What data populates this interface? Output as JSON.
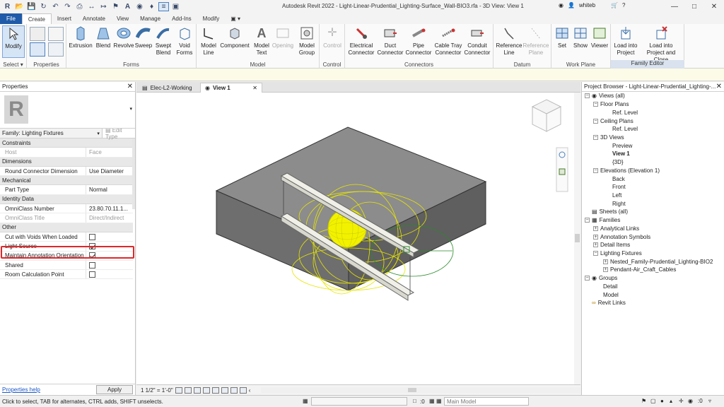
{
  "app": {
    "title": "Autodesk Revit 2022 - Light-Linear-Prudential_Lighting-Surface_Wall-BIO3.rfa - 3D View: View 1",
    "user": "whiteb",
    "logo_letter": "R"
  },
  "menu": {
    "tabs": [
      "File",
      "Create",
      "Insert",
      "Annotate",
      "View",
      "Manage",
      "Add-Ins",
      "Modify"
    ],
    "active": "Create"
  },
  "ribbon": {
    "groups": {
      "select": "Select",
      "properties": "Properties",
      "forms": "Forms",
      "model": "Model",
      "control": "Control",
      "connectors": "Connectors",
      "datum": "Datum",
      "work_plane": "Work Plane",
      "family_editor": "Family Editor"
    },
    "buttons": {
      "modify": "Modify",
      "extrusion": "Extrusion",
      "blend": "Blend",
      "revolve": "Revolve",
      "sweep": "Sweep",
      "swept_blend_1": "Swept",
      "swept_blend_2": "Blend",
      "void_forms_1": "Void",
      "void_forms_2": "Forms",
      "model_line_1": "Model",
      "model_line_2": "Line",
      "component": "Component",
      "model_text_1": "Model",
      "model_text_2": "Text",
      "opening": "Opening",
      "model_group_1": "Model",
      "model_group_2": "Group",
      "control": "Control",
      "electrical_1": "Electrical",
      "electrical_2": "Connector",
      "duct_1": "Duct",
      "duct_2": "Connector",
      "pipe_1": "Pipe",
      "pipe_2": "Connector",
      "cable_tray_1": "Cable Tray",
      "cable_tray_2": "Connector",
      "conduit_1": "Conduit",
      "conduit_2": "Connector",
      "ref_line_1": "Reference",
      "ref_line_2": "Line",
      "ref_plane_1": "Reference",
      "ref_plane_2": "Plane",
      "set": "Set",
      "show": "Show",
      "viewer": "Viewer",
      "load_project_1": "Load into",
      "load_project_2": "Project",
      "load_close_1": "Load into",
      "load_close_2": "Project and Close"
    }
  },
  "properties": {
    "panel_title": "Properties",
    "family": "Family: Lighting Fixtures",
    "edit_type": "Edit Type",
    "categories": {
      "constraints": "Constraints",
      "dimensions": "Dimensions",
      "mechanical": "Mechanical",
      "identity": "Identity Data",
      "other": "Other"
    },
    "rows": {
      "host_name": "Host",
      "host_value": "Face",
      "rcd_name": "Round Connector Dimension",
      "rcd_value": "Use Diameter",
      "part_name": "Part Type",
      "part_value": "Normal",
      "omni_num_name": "OmniClass Number",
      "omni_num_value": "23.80.70.11.1...",
      "omni_title_name": "OmniClass Title",
      "omni_title_value": "Direct/Indirect",
      "cut_voids": "Cut with Voids When Loaded",
      "light_source": "Light Source",
      "maintain_annot": "Maintain Annotation Orientation",
      "shared": "Shared",
      "room_calc": "Room Calculation Point"
    },
    "checkboxes": {
      "cut_voids": false,
      "light_source": true,
      "maintain_annot": true,
      "shared": false,
      "room_calc": false
    },
    "help_link": "Properties help",
    "apply": "Apply"
  },
  "view_tabs": {
    "tab1": "Elec-L2-Working",
    "tab2": "View 1"
  },
  "view_control": {
    "scale": "1 1/2\" = 1'-0\""
  },
  "browser": {
    "title": "Project Browser - Light-Linear-Prudential_Lighting-...",
    "views": "Views (all)",
    "floor_plans": "Floor Plans",
    "ref_level_1": "Ref. Level",
    "ceiling_plans": "Ceiling Plans",
    "ref_level_2": "Ref. Level",
    "views_3d": "3D Views",
    "preview": "Preview",
    "view1": "View 1",
    "view3d": "{3D}",
    "elevations": "Elevations (Elevation 1)",
    "back": "Back",
    "front": "Front",
    "left": "Left",
    "right": "Right",
    "sheets": "Sheets (all)",
    "families": "Families",
    "analytical_links": "Analytical Links",
    "annotation_symbols": "Annotation Symbols",
    "detail_items": "Detail Items",
    "lighting_fixtures": "Lighting Fixtures",
    "nested_family": "Nested_Family-Prudential_Lighting-BIO2",
    "pendant_cables": "Pendant-Air_Craft_Cables",
    "groups": "Groups",
    "detail": "Detail",
    "model": "Model",
    "revit_links": "Revit Links"
  },
  "status": {
    "message": "Click to select, TAB for alternates, CTRL adds, SHIFT unselects.",
    "zero": ":0",
    "main_model": "Main Model"
  },
  "colors": {
    "accent": "#1f5ba8",
    "highlight": "#e0262a",
    "light_yellow": "#f2f200",
    "slab": "#8e8e8e"
  }
}
